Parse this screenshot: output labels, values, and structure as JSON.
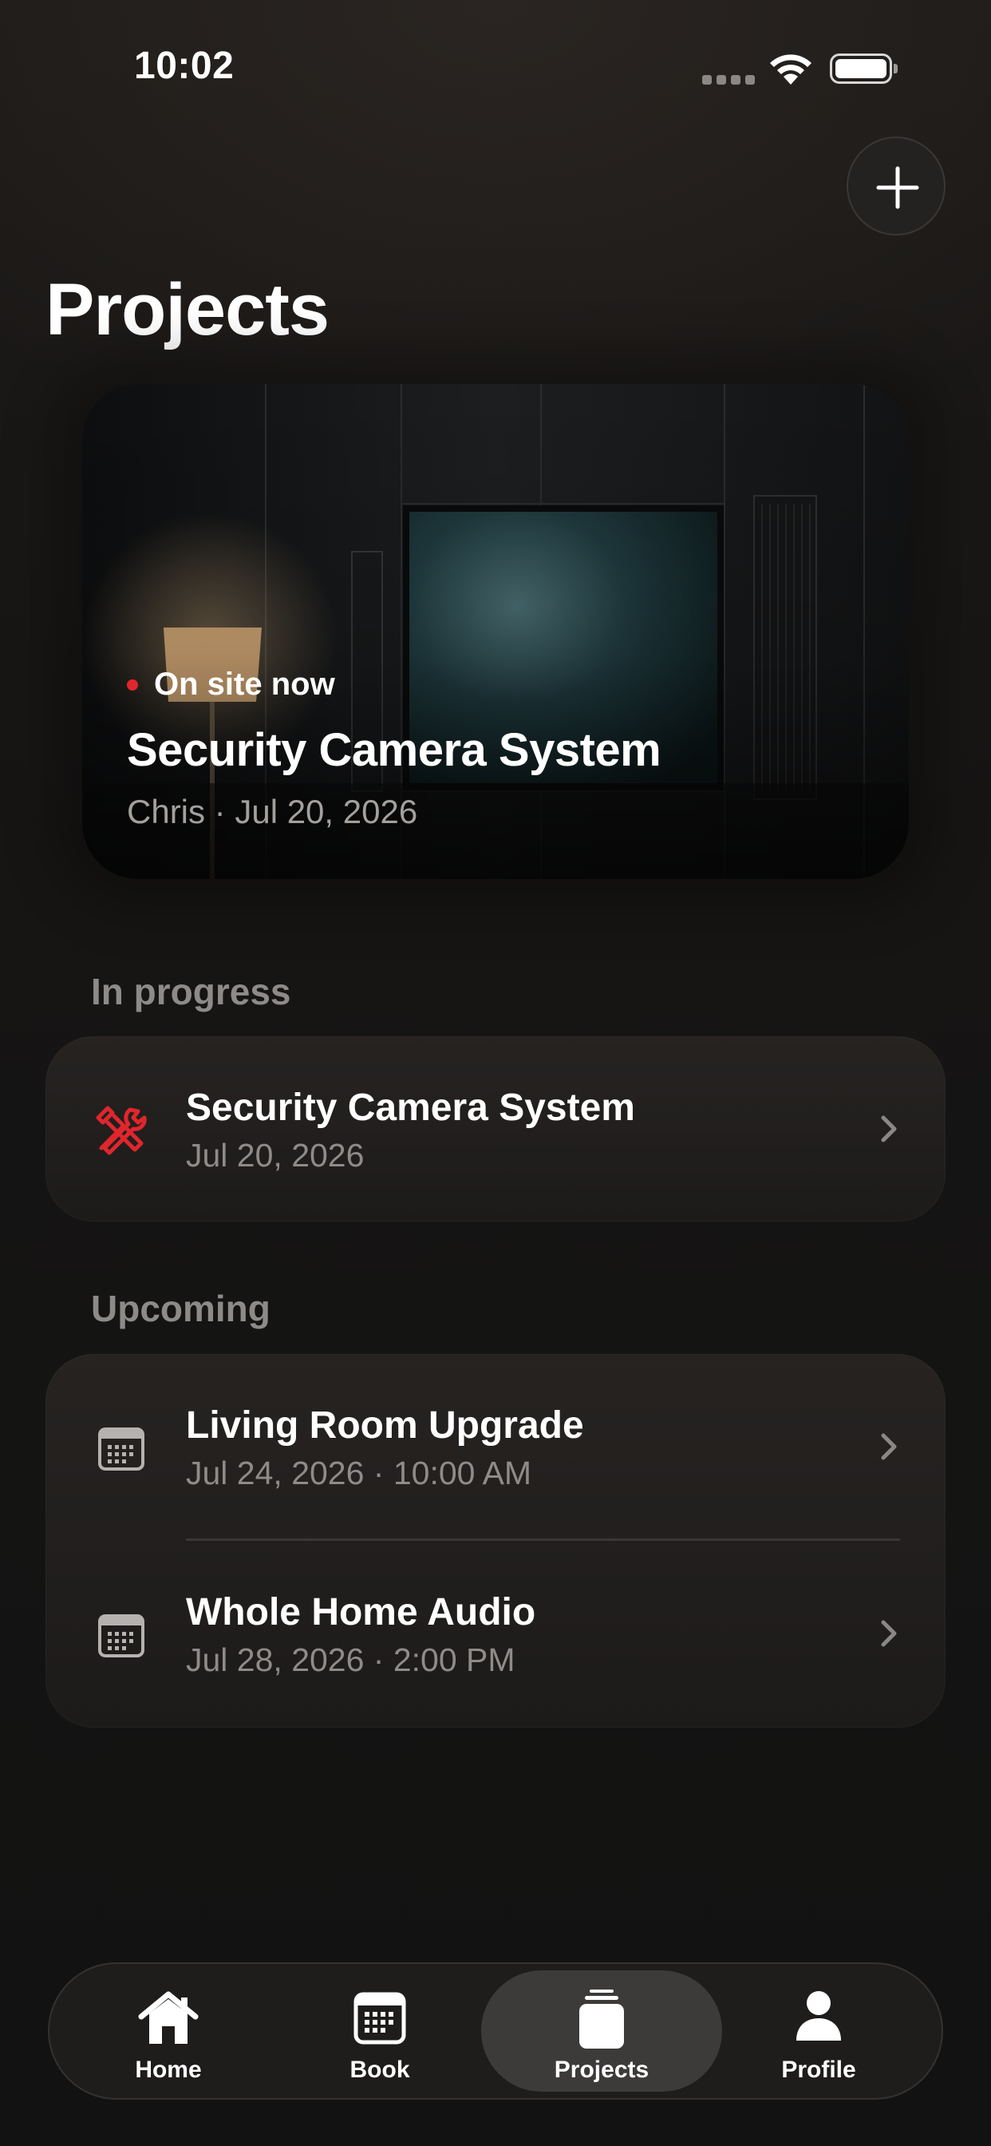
{
  "status_bar": {
    "time": "10:02"
  },
  "header": {
    "title": "Projects"
  },
  "hero": {
    "status": "On site now",
    "title": "Security Camera System",
    "meta": "Chris · Jul 20, 2026"
  },
  "in_progress": {
    "label": "In progress",
    "items": [
      {
        "title": "Security Camera System",
        "subtitle": "Jul 20, 2026",
        "icon": "tools-icon"
      }
    ]
  },
  "upcoming": {
    "label": "Upcoming",
    "items": [
      {
        "title": "Living Room Upgrade",
        "subtitle": "Jul 24, 2026 · 10:00 AM",
        "icon": "calendar-icon"
      },
      {
        "title": "Whole Home Audio",
        "subtitle": "Jul 28, 2026 · 2:00 PM",
        "icon": "calendar-icon"
      }
    ]
  },
  "tab_bar": {
    "tabs": [
      {
        "label": "Home",
        "icon": "home-icon"
      },
      {
        "label": "Book",
        "icon": "calendar-icon"
      },
      {
        "label": "Projects",
        "icon": "projects-icon",
        "active": true
      },
      {
        "label": "Profile",
        "icon": "profile-icon"
      }
    ]
  },
  "colors": {
    "accent_red": "#e0262d",
    "background": "#121212",
    "card": "#262321",
    "secondary_text": "#8e8b89"
  }
}
